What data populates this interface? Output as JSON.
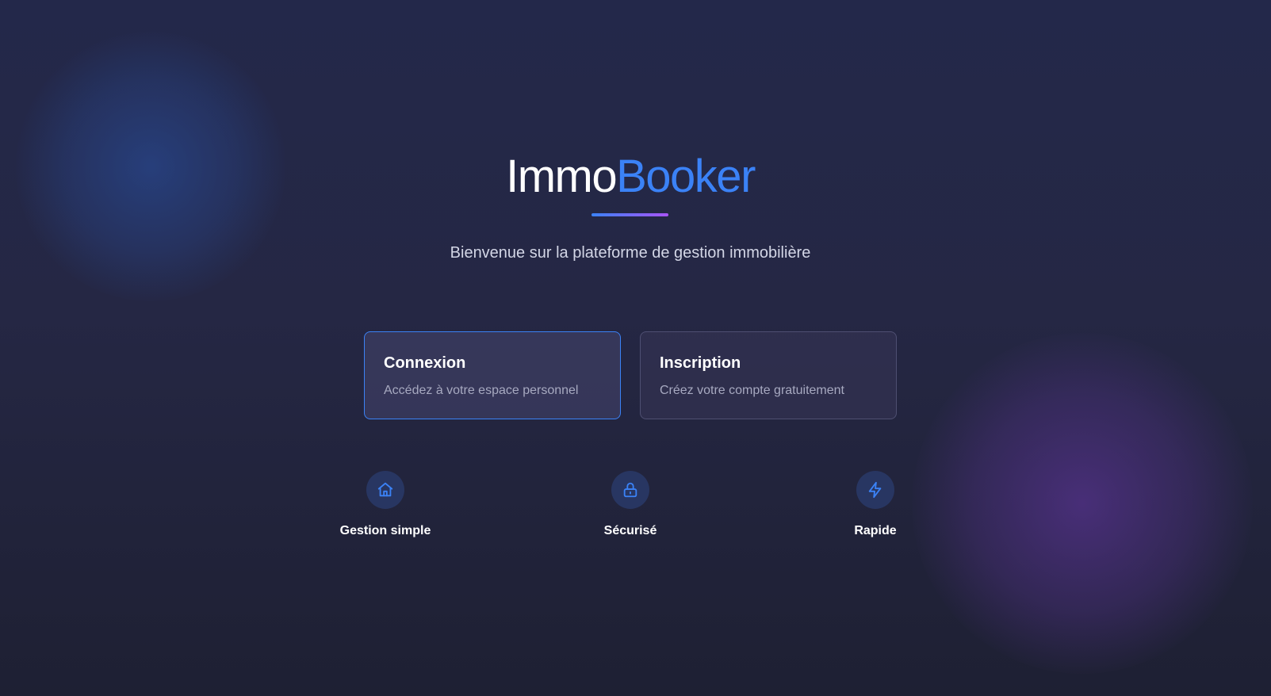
{
  "brand": {
    "part_a": "Immo",
    "part_b": "Booker",
    "accent_color": "#3b82f6",
    "underline_gradient": [
      "#3b82f6",
      "#a855f7"
    ]
  },
  "subtitle": "Bienvenue sur la plateforme de gestion immobilière",
  "cards": [
    {
      "title": "Connexion",
      "description": "Accédez à votre espace personnel",
      "border_color": "#3b82f6"
    },
    {
      "title": "Inscription",
      "description": "Créez votre compte gratuitement"
    }
  ],
  "features": [
    {
      "icon": "home-icon",
      "label": "Gestion simple"
    },
    {
      "icon": "lock-icon",
      "label": "Sécurisé"
    },
    {
      "icon": "lightning-icon",
      "label": "Rapide"
    }
  ],
  "colors": {
    "background": "#23284a",
    "icon_circle": "#283662",
    "icon_stroke": "#3b82f6"
  }
}
